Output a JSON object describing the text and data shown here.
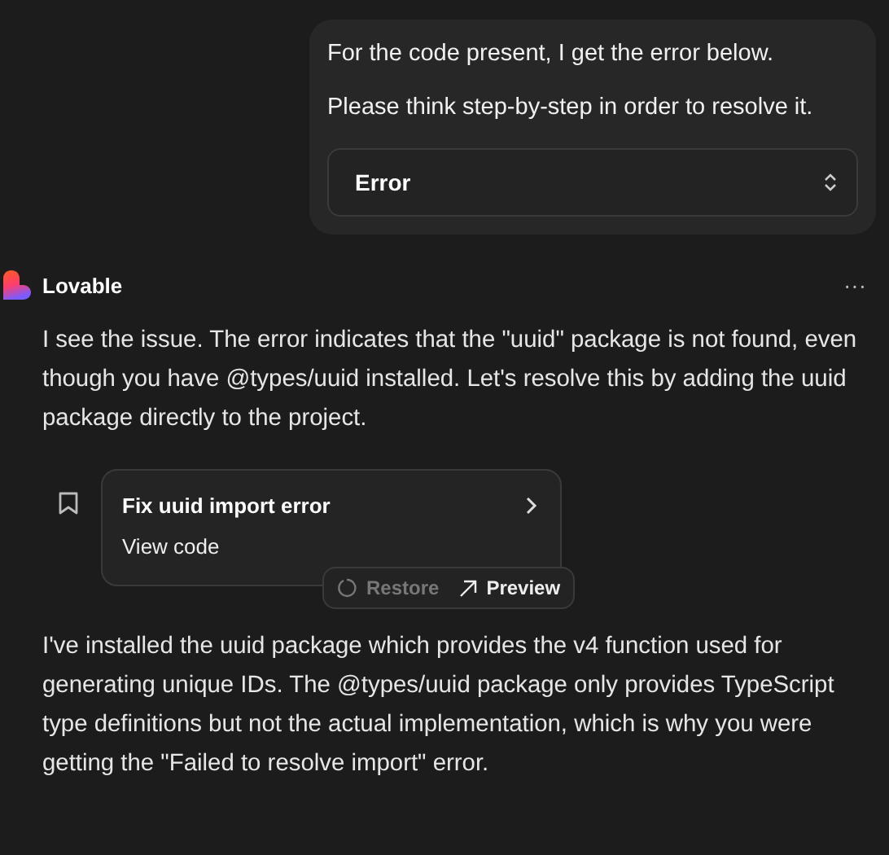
{
  "user_message": {
    "lines": [
      "For the code present, I get the error below.",
      "Please think step-by-step in order to resolve it."
    ],
    "attachment": {
      "label": "Error",
      "expanded": false
    }
  },
  "assistant": {
    "name": "Lovable",
    "menu": "···",
    "paragraphs": [
      "I see the issue. The error indicates that the \"uuid\" package is not found, even though you have @types/uuid installed. Let's resolve this by adding the uuid package directly to the project.",
      "I've installed the uuid package which provides the v4 function used for generating unique IDs. The @types/uuid package only provides TypeScript type definitions but not the actual implementation, which is why you were getting the \"Failed to resolve import\" error."
    ],
    "change_card": {
      "title": "Fix uuid import error",
      "link": "View code",
      "actions": [
        {
          "kind": "restore",
          "label": "Restore",
          "disabled": true
        },
        {
          "kind": "preview",
          "label": "Preview",
          "disabled": false
        }
      ]
    }
  }
}
